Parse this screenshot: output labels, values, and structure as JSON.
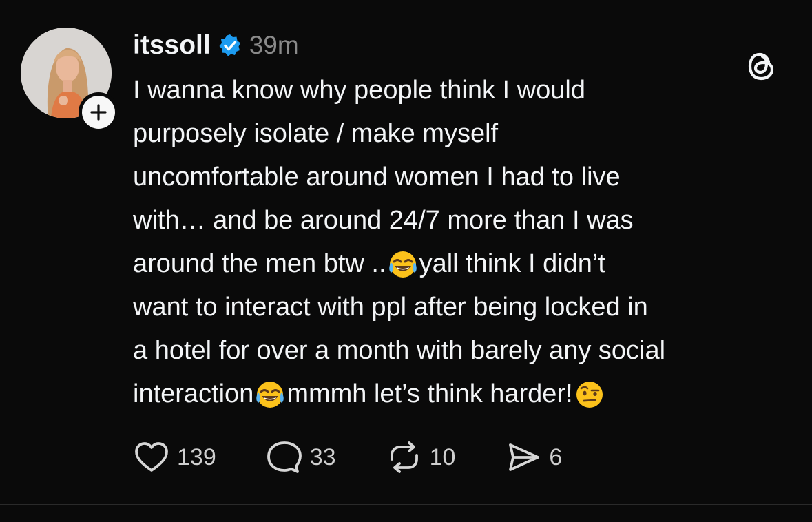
{
  "post": {
    "author": {
      "username": "itssoll",
      "verified": true,
      "avatar_icon": "profile-photo",
      "follow_icon": "plus-icon"
    },
    "timestamp": "39m",
    "app_icon": "threads-logo-icon",
    "text_lines": [
      {
        "parts": [
          "I wanna know why people think I would"
        ]
      },
      {
        "parts": [
          "purposely isolate / make myself"
        ]
      },
      {
        "parts": [
          "uncomfortable around women I had to live"
        ]
      },
      {
        "parts": [
          "with… and be around 24/7 more than I was"
        ]
      },
      {
        "parts": [
          "around the men btw ..",
          " yall think I didn’t"
        ]
      },
      {
        "parts": [
          "want to interact with ppl after being locked in"
        ]
      },
      {
        "parts": [
          "a hotel for over a month with barely any social"
        ]
      },
      {
        "parts": [
          "interaction",
          " mmmh let’s think harder! "
        ]
      }
    ],
    "emojis": {
      "laughing": "face-with-tears-of-joy",
      "raised_eyebrow": "face-with-raised-eyebrow"
    },
    "actions": {
      "likes": "139",
      "replies": "33",
      "reposts": "10",
      "shares": "6"
    },
    "colors": {
      "background": "#0a0a0a",
      "text": "#f3f5f7",
      "muted": "#8a8a8a",
      "verified": "#1d9bf0"
    }
  }
}
